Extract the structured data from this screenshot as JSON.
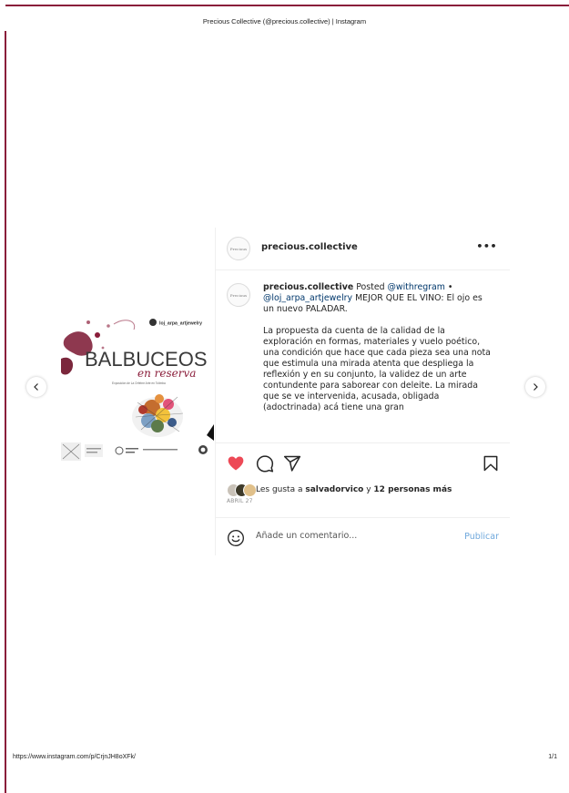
{
  "print": {
    "header_title": "Precious Collective (@precious.collective) | Instagram",
    "footer_url": "https://www.instagram.com/p/CrjnJH8oXFk/",
    "page_number": "1/1"
  },
  "image": {
    "account_tag": "loj_arpa_artjewelry",
    "title": "BALBUCEOS",
    "subtitle": "en reserva",
    "tagline": "Exposición de La Orfebre Arte en Tolimba",
    "site": "www.preciouscollective.com"
  },
  "post": {
    "author": "precious.collective",
    "avatar_mark": "Precious",
    "more_label": "•••",
    "caption": {
      "username": "precious.collective",
      "posted": " Posted ",
      "mention_1": "@withregram",
      "bullet": " •",
      "mention_2": "@loj_arpa_artjewelry",
      "line_1": " MEJOR QUE EL VINO: El ojo es un nuevo PALADAR.",
      "paragraph_2": "La propuesta da cuenta de la calidad de la exploración en formas, materiales y vuelo poético, una condición que hace que cada pieza sea una nota que estimula una mirada atenta que despliega la reflexión y en su conjunto, la validez de un arte contundente para saborear con deleite. La mirada que se ve intervenida, acusada, obligada (adoctrinada) acá tiene una gran"
    },
    "likes": {
      "prefix": "Les gusta a ",
      "user": "salvadorvico",
      "middle": " y ",
      "others": "12 personas más"
    },
    "date": "ABRIL 27",
    "comment": {
      "placeholder": "Añade un comentario...",
      "publish_label": "Publicar"
    }
  },
  "icons": {
    "prev": "chevron-left-icon",
    "next": "chevron-right-icon",
    "like": "heart-icon",
    "comment": "comment-icon",
    "share": "send-icon",
    "save": "bookmark-icon",
    "emoji": "smiley-icon"
  },
  "colors": {
    "like": "#ed4956",
    "link": "#00376b",
    "publish": "#6fa8dc",
    "title_wine": "#8a1d3a",
    "crop_marks": "#8a1d3a"
  }
}
